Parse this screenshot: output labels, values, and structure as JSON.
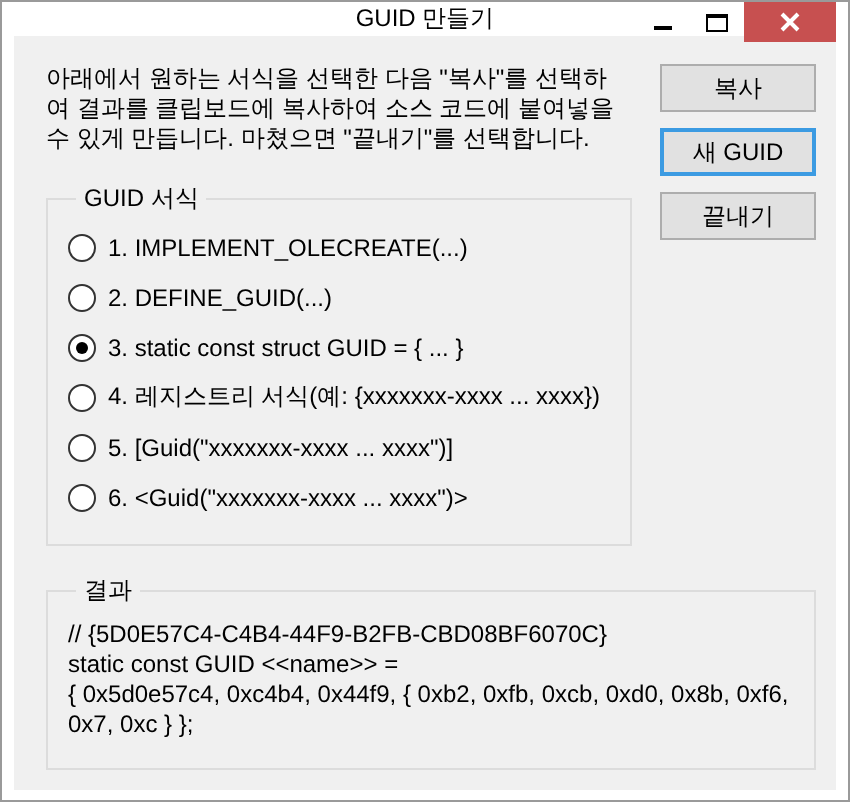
{
  "window": {
    "title": "GUID 만들기"
  },
  "description": "아래에서 원하는 서식을 선택한 다음 \"복사\"를 선택하여 결과를 클립보드에 복사하여 소스 코드에 붙여넣을 수 있게 만듭니다. 마쳤으면 \"끝내기\"를 선택합니다.",
  "buttons": [
    {
      "label": "복사",
      "default": false
    },
    {
      "label": "새 GUID",
      "default": true
    },
    {
      "label": "끝내기",
      "default": false
    }
  ],
  "format_group": {
    "title": "GUID 서식",
    "options": [
      {
        "label": "1. IMPLEMENT_OLECREATE(...)",
        "selected": false
      },
      {
        "label": "2. DEFINE_GUID(...)",
        "selected": false
      },
      {
        "label": "3. static const struct GUID = { ... }",
        "selected": true
      },
      {
        "label": "4. 레지스트리 서식(예: {xxxxxxx-xxxx ... xxxx})",
        "selected": false
      },
      {
        "label": "5. [Guid(\"xxxxxxx-xxxx ... xxxx\")]",
        "selected": false
      },
      {
        "label": "6. <Guid(\"xxxxxxx-xxxx ... xxxx\")>",
        "selected": false
      }
    ]
  },
  "result_group": {
    "title": "결과",
    "lines": [
      "// {5D0E57C4-C4B4-44F9-B2FB-CBD08BF6070C}",
      "static const GUID <<name>> =",
      "{ 0x5d0e57c4, 0xc4b4, 0x44f9, { 0xb2, 0xfb, 0xcb, 0xd0, 0x8b, 0xf6,",
      "0x7, 0xc } };"
    ]
  }
}
